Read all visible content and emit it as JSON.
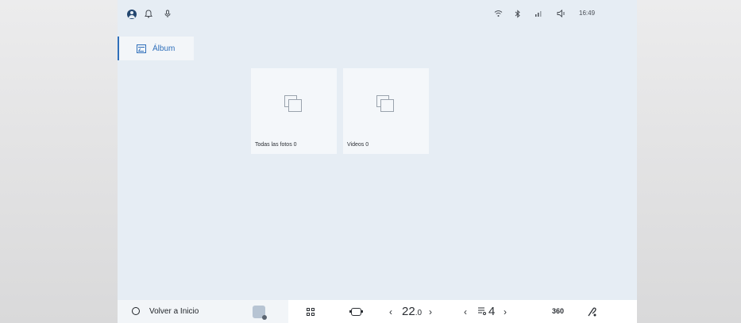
{
  "status_bar": {
    "time": "16:49",
    "icons": [
      "profile-avatar",
      "bell-icon",
      "microphone-icon",
      "wifi-icon",
      "bluetooth-icon",
      "signal-icon",
      "volume-icon"
    ]
  },
  "tabs": [
    {
      "label": "Álbum",
      "icon": "album-icon",
      "active": true
    }
  ],
  "albums": [
    {
      "label": "Todas las fotos 0",
      "icon": "album-stack-icon"
    },
    {
      "label": "Videos 0",
      "icon": "album-stack-icon"
    }
  ],
  "dock": {
    "home_label": "Volver a Inicio",
    "left_temp_value": "22",
    "left_temp_unit": ".0",
    "right_temp_value": "4",
    "three_sixty_label": "360"
  },
  "colors": {
    "accent": "#2f6fba",
    "screen_bg": "#e6edf4",
    "card_bg": "#f4f7fa"
  }
}
